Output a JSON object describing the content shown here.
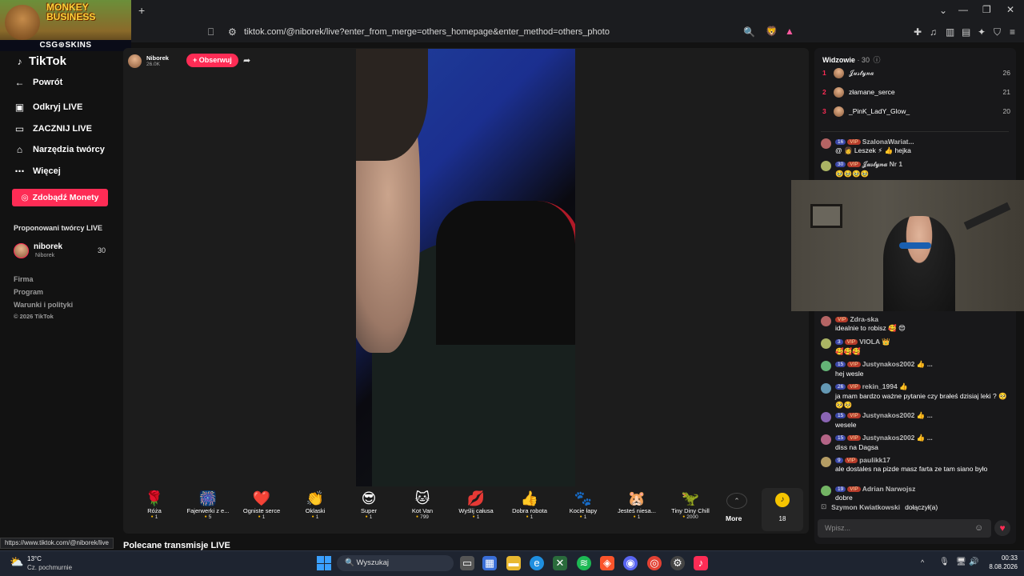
{
  "browser": {
    "promo": {
      "title_line1": "MONKEY",
      "title_line2": "BUSINESS",
      "brand": "CSG⊛SKINS"
    },
    "new_tab_symbol": "+",
    "url": "tiktok.com/@niborek/live?enter_from_merge=others_homepage&enter_method=others_photo",
    "status_url": "https://www.tiktok.com/@niborek/live"
  },
  "sidebar": {
    "logo": "TikTok",
    "back": "Powrót",
    "items": [
      {
        "label": "Odkryj LIVE",
        "icon": "live-grid-icon"
      },
      {
        "label": "ZACZNIJ LIVE",
        "icon": "camera-icon"
      },
      {
        "label": "Narzędzia twórcy",
        "icon": "home-icon"
      },
      {
        "label": "Więcej",
        "icon": "more-dots-icon"
      }
    ],
    "coins_button": "Zdobądź Monety",
    "suggested_heading": "Proponowani twórcy LIVE",
    "suggested": {
      "name": "niborek",
      "sub": "Niborek",
      "count": "30"
    },
    "footer": [
      "Firma",
      "Program",
      "Warunki i polityki",
      "© 2026 TikTok"
    ]
  },
  "stream": {
    "host_name": "Niborek",
    "host_likes": "26.0K",
    "follow_label": "+ Obserwuj",
    "below_title": "Polecane transmisje LIVE"
  },
  "gifts": [
    {
      "name": "Róża",
      "price": "1",
      "icon": "🌹"
    },
    {
      "name": "Fajerwerki z e...",
      "price": "5",
      "icon": "🎆"
    },
    {
      "name": "Ogniste serce",
      "price": "1",
      "icon": "❤️"
    },
    {
      "name": "Oklaski",
      "price": "1",
      "icon": "👏"
    },
    {
      "name": "Super",
      "price": "1",
      "icon": "😎"
    },
    {
      "name": "Kot Van",
      "price": "799",
      "icon": "🐱"
    },
    {
      "name": "Wyślij całusa",
      "price": "1",
      "icon": "💋"
    },
    {
      "name": "Dobra robota",
      "price": "1",
      "icon": "👍"
    },
    {
      "name": "Kocie łapy",
      "price": "1",
      "icon": "🐾"
    },
    {
      "name": "Jesteś niesa...",
      "price": "1",
      "icon": "🐹"
    },
    {
      "name": "Tiny Diny Chill",
      "price": "2000",
      "icon": "🦖"
    }
  ],
  "gift_more": "More",
  "coin_count": "18",
  "panel": {
    "viewers_label": "Widzowie",
    "viewers_count": "· 30",
    "top_viewers": [
      {
        "rank": "1",
        "name": "𝒥𝓊𝓈𝓉𝓎𝓃𝒶",
        "score": "26"
      },
      {
        "rank": "2",
        "name": "złamane_serce",
        "score": "21"
      },
      {
        "rank": "3",
        "name": "_PinK_LadY_Glow_",
        "score": "20"
      }
    ],
    "chat_top": [
      {
        "badge_lvl": "16",
        "name": "SzalonaWariat...",
        "text": "@ 👩 Leszek ⚡ 👍 hejka"
      },
      {
        "badge_lvl": "30",
        "name": "𝒥𝓊𝓈𝓉𝓎𝓃𝒶  Nr 1",
        "text": "🥹🥹🥹🥹"
      }
    ],
    "chat": [
      {
        "badge_lvl": "",
        "name": "Zdra-ska",
        "text": "idealnie to robisz 🥰 😍"
      },
      {
        "badge_lvl": "3",
        "name": "VIOLA 👑",
        "text": "🥰🥰🥰"
      },
      {
        "badge_lvl": "15",
        "name": "Justynakos2002 👍 ...",
        "text": "hej wesle"
      },
      {
        "badge_lvl": "26",
        "name": "rekin_1994 👍",
        "text": "ja mam bardzo ważne pytanie czy brałeś dzisiaj leki ? 🥺🥺🥺"
      },
      {
        "badge_lvl": "15",
        "name": "Justynakos2002 👍 ...",
        "text": "wesele"
      },
      {
        "badge_lvl": "15",
        "name": "Justynakos2002 👍 ...",
        "text": "diss na Dagsa"
      },
      {
        "badge_lvl": "9",
        "name": "paulikk17",
        "text": "ale dostales na pizde masz farta ze tam siano było"
      },
      {
        "badge_lvl": "19",
        "name": "Adrian Narwojsz",
        "text": "dobre"
      }
    ],
    "join_msg_name": "Szymon Kwiatkowski",
    "join_msg_text": "dołączył(a)",
    "input_placeholder": "Wpisz..."
  },
  "taskbar": {
    "weather_temp": "13°C",
    "weather_desc": "Cz. pochmurnie",
    "search_placeholder": "Wyszukaj",
    "time": "00:33",
    "date": "8.08.2026"
  },
  "colors": {
    "accent": "#fe2c55",
    "bg": "#121212",
    "panel": "#18181a"
  }
}
